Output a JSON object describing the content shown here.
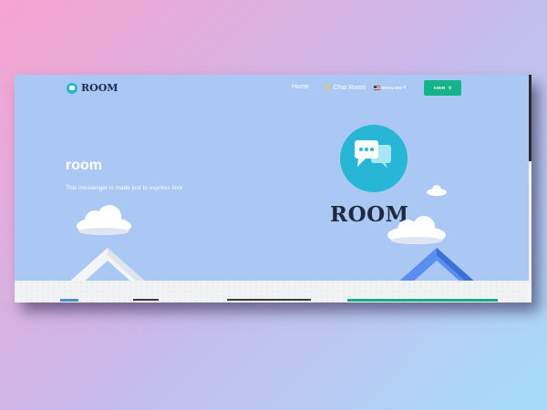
{
  "navbar": {
    "brand": "ROOM",
    "links": [
      "Home",
      "Chat Room"
    ],
    "language": "ENGLISH",
    "user_button": "AMIR"
  },
  "hero": {
    "title": "room",
    "subtitle": "This messenger is made just to express love",
    "brand_word": "ROOM"
  },
  "icons": [
    "logo-icon",
    "chat-bubbles-icon",
    "flag-icon",
    "lightning-icon"
  ],
  "colors": {
    "hero_bg": "#abc8f5",
    "accent_button": "#16b38a",
    "brand_circle": "#27b6d6"
  }
}
